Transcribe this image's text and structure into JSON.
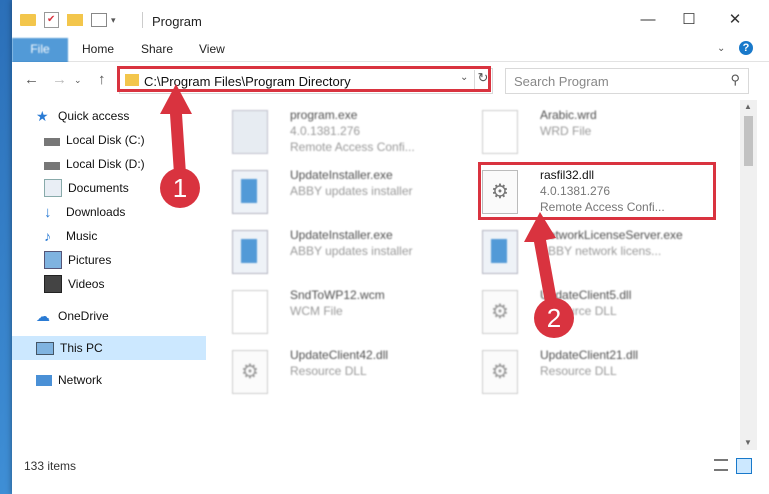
{
  "window": {
    "title": "Program"
  },
  "ribbon": {
    "tabs": [
      "File",
      "Home",
      "Share",
      "View"
    ]
  },
  "address": {
    "path": "C:\\Program Files\\Program Directory",
    "search_placeholder": "Search Program"
  },
  "sidebar": {
    "items": [
      {
        "label": "Quick access",
        "icon": "star-icon"
      },
      {
        "label": "Local Disk (C:)",
        "icon": "drive-icon"
      },
      {
        "label": "Local Disk (D:)",
        "icon": "drive-icon"
      },
      {
        "label": "Documents",
        "icon": "documents-icon"
      },
      {
        "label": "Downloads",
        "icon": "download-icon"
      },
      {
        "label": "Music",
        "icon": "music-icon"
      },
      {
        "label": "Pictures",
        "icon": "pictures-icon"
      },
      {
        "label": "Videos",
        "icon": "videos-icon"
      },
      {
        "label": "OneDrive",
        "icon": "cloud-icon"
      },
      {
        "label": "This PC",
        "icon": "computer-icon"
      },
      {
        "label": "Network",
        "icon": "network-icon"
      }
    ]
  },
  "files": [
    {
      "name": "program.exe",
      "version": "4.0.1381.276",
      "desc": "Remote Access Confi..."
    },
    {
      "name": "Arabic.wrd",
      "version": "WRD File",
      "desc": ""
    },
    {
      "name": "UpdateInstaller.exe",
      "version": "ABBY updates installer",
      "desc": ""
    },
    {
      "name": "rasfil32.dll",
      "version": "4.0.1381.276",
      "desc": "Remote Access Confi..."
    },
    {
      "name": "UpdateInstaller.exe",
      "version": "ABBY updates installer",
      "desc": ""
    },
    {
      "name": "NetworkLicenseServer.exe",
      "version": "ABBY network licens...",
      "desc": ""
    },
    {
      "name": "SndToWP12.wcm",
      "version": "WCM File",
      "desc": ""
    },
    {
      "name": "UpdateClient5.dll",
      "version": "Resource DLL",
      "desc": ""
    },
    {
      "name": "UpdateClient42.dll",
      "version": "Resource DLL",
      "desc": ""
    },
    {
      "name": "UpdateClient21.dll",
      "version": "Resource DLL",
      "desc": ""
    }
  ],
  "status": {
    "count": "133 items"
  },
  "annotations": {
    "step1": "1",
    "step2": "2"
  },
  "colors": {
    "accent": "#1979ca",
    "highlight": "#d9333f",
    "selected": "#cce8ff"
  }
}
